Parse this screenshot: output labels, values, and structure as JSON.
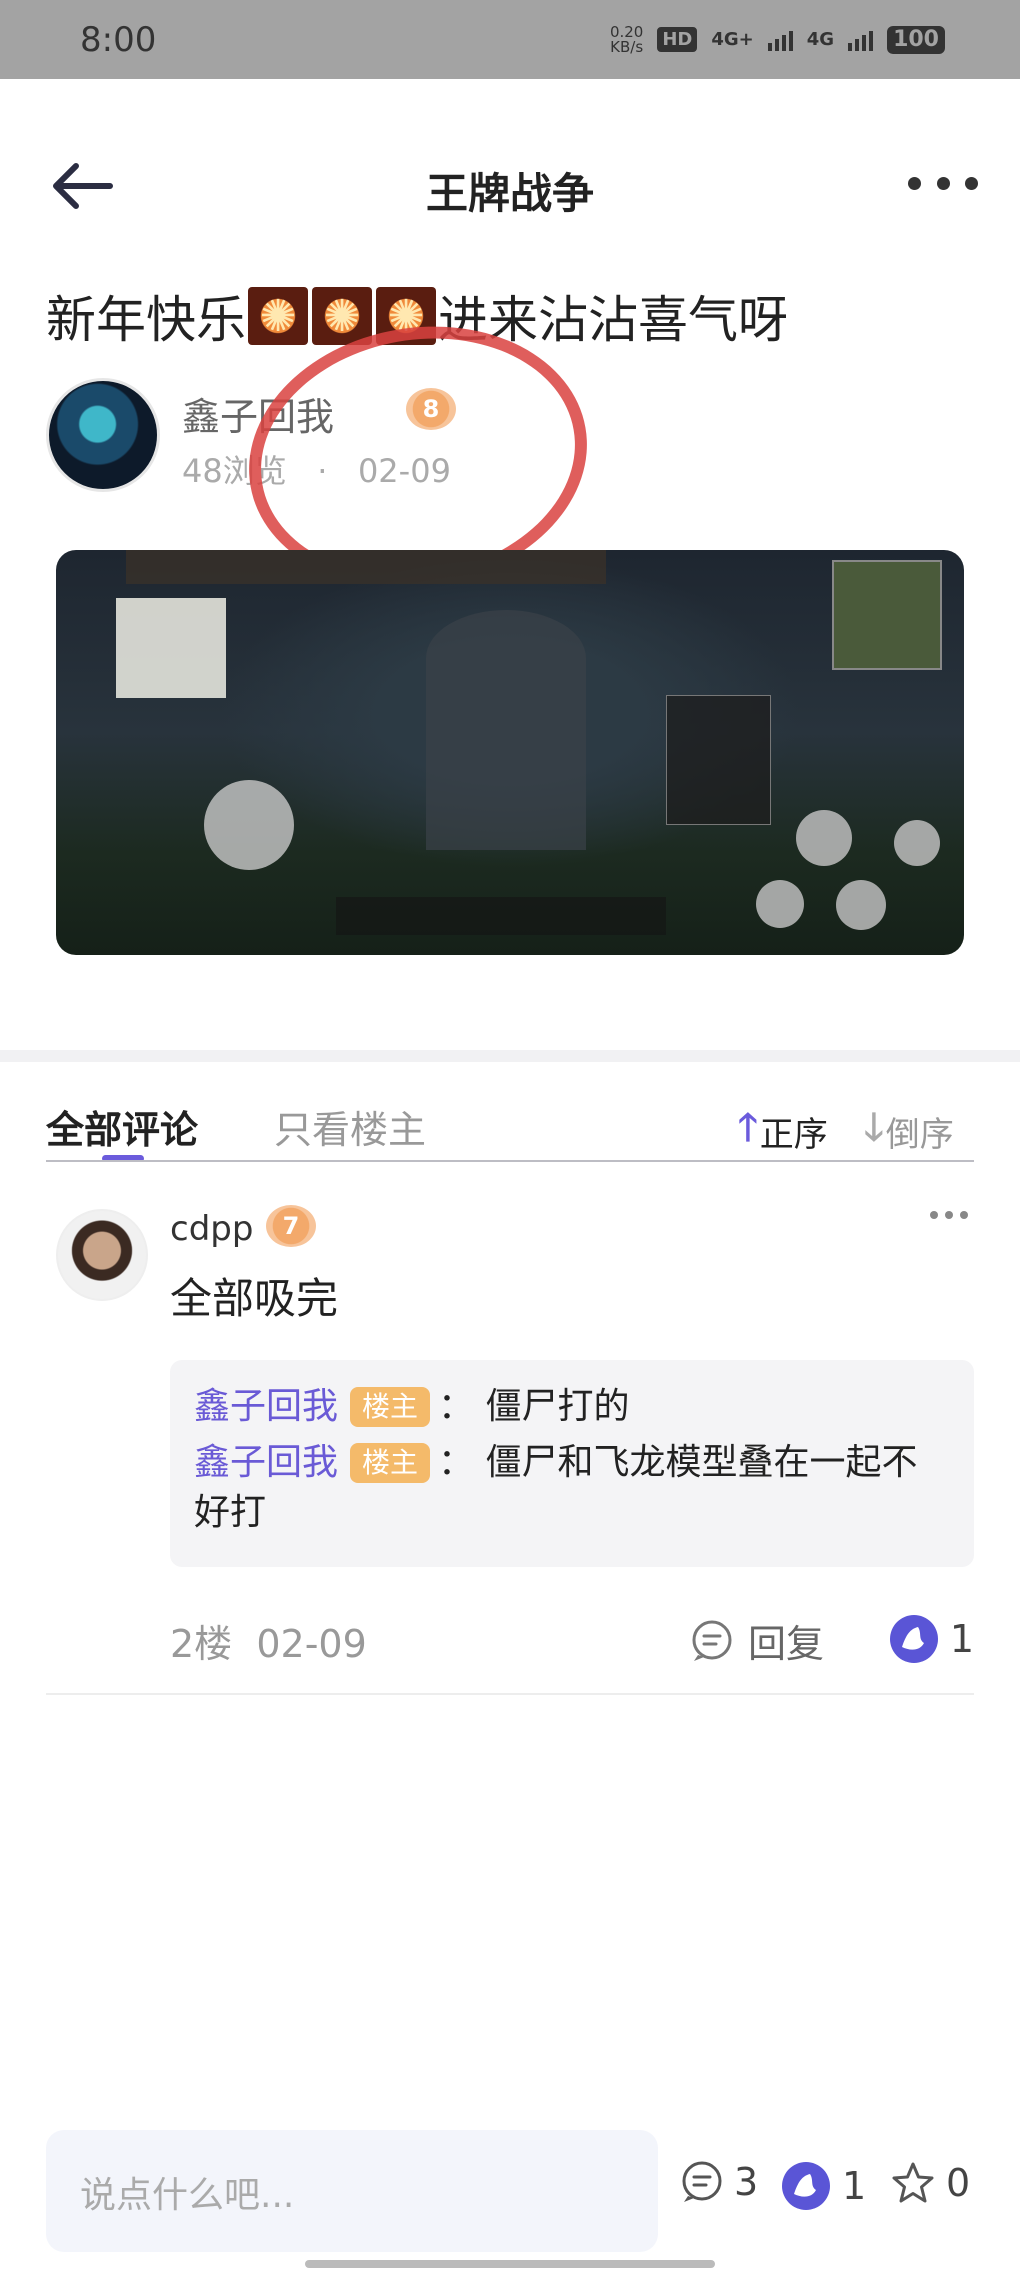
{
  "status_bar": {
    "time": "8:00",
    "net_speed_value": "0.20",
    "net_speed_unit": "KB/s",
    "hd": "HD",
    "network_1": "4G+",
    "network_2": "4G",
    "battery": "100"
  },
  "nav": {
    "title": "王牌战争",
    "back_icon": "arrow-left-icon",
    "more_icon": "more-horizontal-icon"
  },
  "post": {
    "title": "新年快乐",
    "title_suffix": "进来沾沾喜气呀",
    "author_name": "鑫子回我",
    "author_level": "8",
    "views": "48浏览",
    "separator": "·",
    "date": "02-09"
  },
  "tabs": {
    "all_comments": "全部评论",
    "only_op": "只看楼主",
    "sort_asc": "正序",
    "sort_desc": "倒序"
  },
  "comment": {
    "name": "cdpp",
    "level": "7",
    "text": "全部吸完",
    "replies": [
      {
        "who": "鑫子回我",
        "tag": "楼主",
        "colon": "：",
        "text": "僵尸打的"
      },
      {
        "who": "鑫子回我",
        "tag": "楼主",
        "colon": "：",
        "text": "僵尸和飞龙模型叠在一起不好打"
      }
    ],
    "floor": "2楼",
    "date": "02-09",
    "reply_label": "回复",
    "likes": "1"
  },
  "bottom_bar": {
    "input_placeholder": "说点什么吧...",
    "comments_count": "3",
    "likes_count": "1",
    "stars_count": "0"
  },
  "colors": {
    "accent": "#6b5bdc",
    "op_tag": "#f4ba6a",
    "level_badge": "#f3a96b",
    "annotation_circle": "#d9423f"
  }
}
